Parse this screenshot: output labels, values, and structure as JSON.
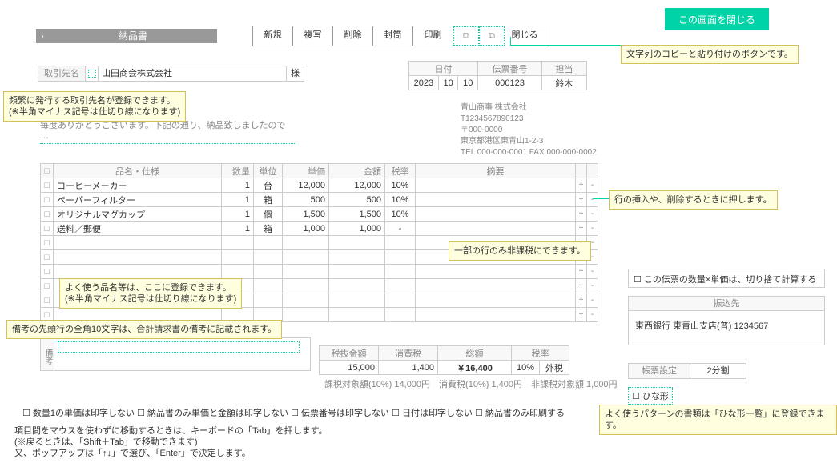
{
  "close_screen": "この画面を閉じる",
  "title": "納品書",
  "toolbar": {
    "new": "新規",
    "copy": "複写",
    "delete": "削除",
    "envelope": "封筒",
    "print": "印刷",
    "close": "閉じる"
  },
  "partner": {
    "label": "取引先名",
    "value": "山田商会株式会社",
    "suffix": "様"
  },
  "header": {
    "date_label": "日付",
    "slip_no_label": "伝票番号",
    "person_label": "担当",
    "date_y": "2023",
    "date_m": "10",
    "date_d": "10",
    "slip_no": "000123",
    "person": "鈴木"
  },
  "greeting": "毎度ありがとうございます。下記の通り、納品致しましたので …",
  "company": {
    "name": "青山商事 株式会社",
    "reg": "T1234567890123",
    "zip": "〒000-0000",
    "addr": "東京都港区東青山1-2-3",
    "tel": "TEL 000-000-0001  FAX 000-000-0002"
  },
  "cols": {
    "name": "品名・仕様",
    "qty": "数量",
    "unit": "単位",
    "price": "単価",
    "amount": "金額",
    "rate": "税率",
    "summary": "摘要"
  },
  "rows": [
    {
      "name": "コーヒーメーカー",
      "qty": "1",
      "unit": "台",
      "price": "12,000",
      "amount": "12,000",
      "rate": "10%"
    },
    {
      "name": "ペーパーフィルター",
      "qty": "1",
      "unit": "箱",
      "price": "500",
      "amount": "500",
      "rate": "10%"
    },
    {
      "name": "オリジナルマグカップ",
      "qty": "1",
      "unit": "個",
      "price": "1,500",
      "amount": "1,500",
      "rate": "10%"
    },
    {
      "name": "送料／郵便",
      "qty": "1",
      "unit": "箱",
      "price": "1,000",
      "amount": "1,000",
      "rate": "-"
    }
  ],
  "remarks_label": "備考",
  "totals": {
    "subtotal_label": "税抜金額",
    "tax_label": "消費税",
    "total_label": "総額",
    "rate_label": "税率",
    "subtotal": "15,000",
    "tax": "1,400",
    "total": "￥16,400",
    "rate": "10%",
    "tax_type": "外税"
  },
  "tax_breakdown": "課税対象額(10%) 14,000円　消費税(10%) 1,400円　非課税対象額 1,000円",
  "print_opts": {
    "a": "数量1の単価は印字しない",
    "b": "納品書のみ単価と金額は印字しない",
    "c": "伝票番号は印字しない",
    "d": "日付は印字しない",
    "e": "納品書のみ印刷する"
  },
  "tips": {
    "tab1": "項目間をマウスを使わずに移動するときは、キーボードの「Tab」を押します。",
    "tab2": "(※戻るときは、「Shift＋Tab」で移動できます)",
    "tab3": "又、ポップアップは「↑↓」で選び、「Enter」で決定します。"
  },
  "rounding": "この伝票の数量×単価は、切り捨て計算する",
  "transfer": {
    "label": "振込先",
    "value": "東西銀行  東青山支店(普) 1234567"
  },
  "slip_setting": {
    "label": "帳票設定",
    "value": "2分割"
  },
  "template_check": "ひな形",
  "tooltips": {
    "copy_paste": "文字列のコピーと貼り付けのボタンです。",
    "partner": "頻繁に発行する取引先名が登録できます。\n(※半角マイナス記号は仕切り線になります)",
    "row_ops": "行の挿入や、削除するときに押します。",
    "nontax": "一部の行のみ非課税にできます。",
    "item_reg": "よく使う品名等は、ここに登録できます。\n(※半角マイナス記号は仕切り線になります)",
    "remarks": "備考の先頭行の全角10文字は、合計請求書の備考に記載されます。",
    "template": "よく使うパターンの書類は「ひな形一覧」に登録できます。"
  }
}
